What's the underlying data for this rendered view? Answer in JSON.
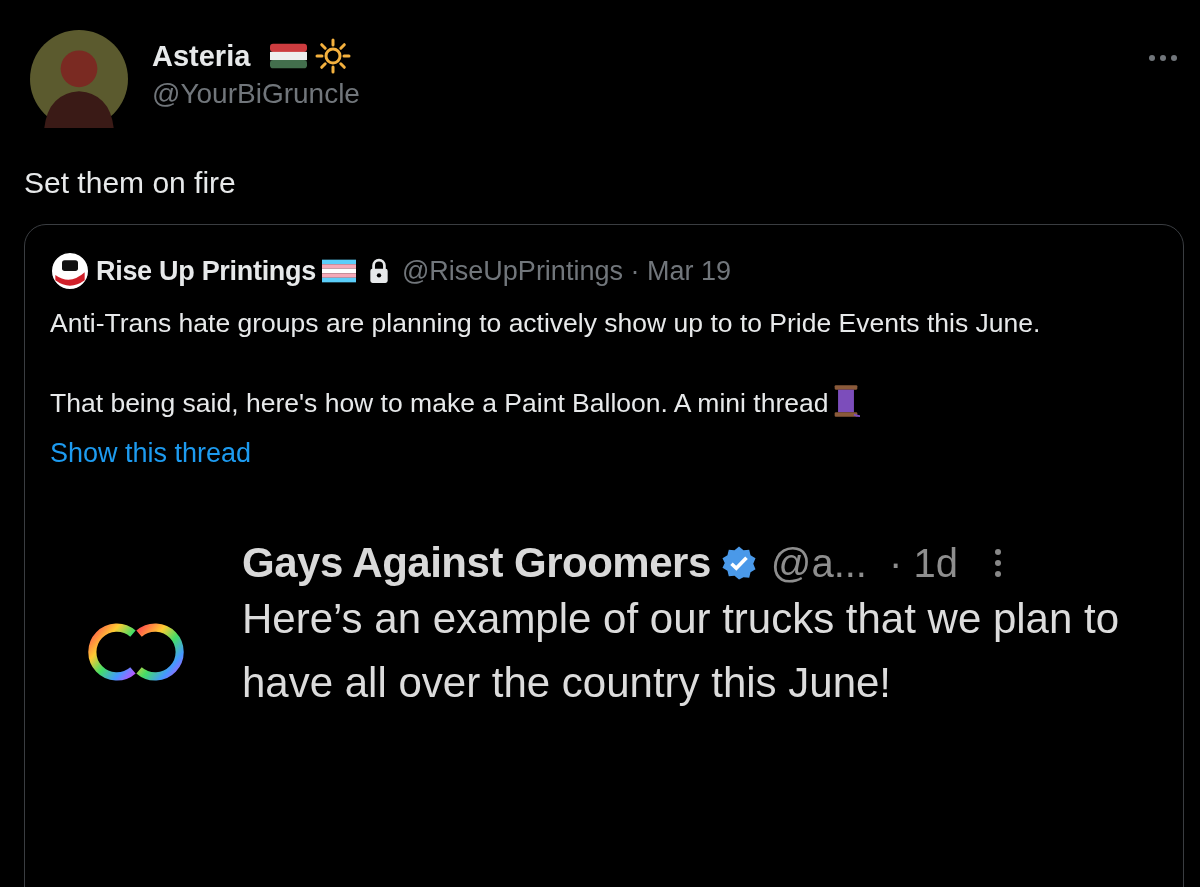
{
  "post": {
    "author": {
      "name": "Asteria",
      "handle": "@YourBiGruncle"
    },
    "text": "Set them on fire",
    "quoted": {
      "author": {
        "name": "Rise Up Printings",
        "locked": true,
        "meta": "@RiseUpPrintings · Mar 19"
      },
      "paragraphs": [
        "Anti-Trans hate groups are planning to actively show up to to Pride Events this June.",
        "That being said, here's how to make a Paint Balloon. A mini thread"
      ],
      "link": "Show this thread",
      "embedded": {
        "author": {
          "name": "Gays Against Groomers",
          "verified": true,
          "handle": "@a...",
          "time": "· 1d"
        },
        "text": "Here’s an example of our trucks that we plan to have all over the country this June!"
      }
    }
  }
}
